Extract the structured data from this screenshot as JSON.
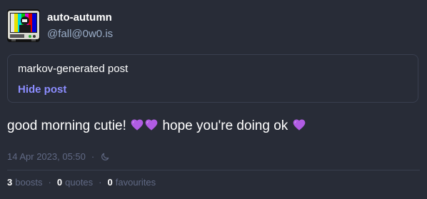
{
  "account": {
    "display_name": "auto-autumn",
    "acct": "@fall@0w0.is"
  },
  "content_warning": {
    "text": "markov-generated post",
    "toggle_label": "Hide post"
  },
  "content": {
    "part1": "good morning cutie! ",
    "part2": " hope you're doing ok ",
    "emoji": "purple-heart-icon"
  },
  "meta": {
    "timestamp": "14 Apr 2023, 05:50",
    "separator": "·",
    "visibility_icon": "moon-icon"
  },
  "counts": {
    "boosts_count": "3",
    "boosts_label": "boosts",
    "quotes_count": "0",
    "quotes_label": "quotes",
    "favourites_count": "0",
    "favourites_label": "favourites",
    "separator": "·"
  },
  "colors": {
    "background": "#282c37",
    "accent": "#8c8dff",
    "muted": "#606984",
    "secondary": "#9baec8",
    "heart": "#b05ce3"
  }
}
